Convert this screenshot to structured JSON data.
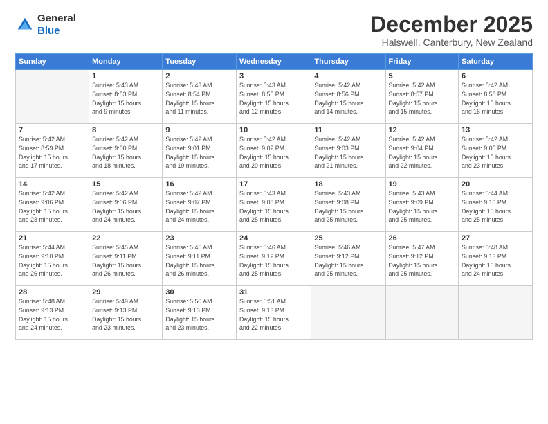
{
  "header": {
    "logo_general": "General",
    "logo_blue": "Blue",
    "month_title": "December 2025",
    "location": "Halswell, Canterbury, New Zealand"
  },
  "days_of_week": [
    "Sunday",
    "Monday",
    "Tuesday",
    "Wednesday",
    "Thursday",
    "Friday",
    "Saturday"
  ],
  "weeks": [
    [
      {
        "day": "",
        "info": ""
      },
      {
        "day": "1",
        "info": "Sunrise: 5:43 AM\nSunset: 8:53 PM\nDaylight: 15 hours\nand 9 minutes."
      },
      {
        "day": "2",
        "info": "Sunrise: 5:43 AM\nSunset: 8:54 PM\nDaylight: 15 hours\nand 11 minutes."
      },
      {
        "day": "3",
        "info": "Sunrise: 5:43 AM\nSunset: 8:55 PM\nDaylight: 15 hours\nand 12 minutes."
      },
      {
        "day": "4",
        "info": "Sunrise: 5:42 AM\nSunset: 8:56 PM\nDaylight: 15 hours\nand 14 minutes."
      },
      {
        "day": "5",
        "info": "Sunrise: 5:42 AM\nSunset: 8:57 PM\nDaylight: 15 hours\nand 15 minutes."
      },
      {
        "day": "6",
        "info": "Sunrise: 5:42 AM\nSunset: 8:58 PM\nDaylight: 15 hours\nand 16 minutes."
      }
    ],
    [
      {
        "day": "7",
        "info": "Sunrise: 5:42 AM\nSunset: 8:59 PM\nDaylight: 15 hours\nand 17 minutes."
      },
      {
        "day": "8",
        "info": "Sunrise: 5:42 AM\nSunset: 9:00 PM\nDaylight: 15 hours\nand 18 minutes."
      },
      {
        "day": "9",
        "info": "Sunrise: 5:42 AM\nSunset: 9:01 PM\nDaylight: 15 hours\nand 19 minutes."
      },
      {
        "day": "10",
        "info": "Sunrise: 5:42 AM\nSunset: 9:02 PM\nDaylight: 15 hours\nand 20 minutes."
      },
      {
        "day": "11",
        "info": "Sunrise: 5:42 AM\nSunset: 9:03 PM\nDaylight: 15 hours\nand 21 minutes."
      },
      {
        "day": "12",
        "info": "Sunrise: 5:42 AM\nSunset: 9:04 PM\nDaylight: 15 hours\nand 22 minutes."
      },
      {
        "day": "13",
        "info": "Sunrise: 5:42 AM\nSunset: 9:05 PM\nDaylight: 15 hours\nand 23 minutes."
      }
    ],
    [
      {
        "day": "14",
        "info": "Sunrise: 5:42 AM\nSunset: 9:06 PM\nDaylight: 15 hours\nand 23 minutes."
      },
      {
        "day": "15",
        "info": "Sunrise: 5:42 AM\nSunset: 9:06 PM\nDaylight: 15 hours\nand 24 minutes."
      },
      {
        "day": "16",
        "info": "Sunrise: 5:42 AM\nSunset: 9:07 PM\nDaylight: 15 hours\nand 24 minutes."
      },
      {
        "day": "17",
        "info": "Sunrise: 5:43 AM\nSunset: 9:08 PM\nDaylight: 15 hours\nand 25 minutes."
      },
      {
        "day": "18",
        "info": "Sunrise: 5:43 AM\nSunset: 9:08 PM\nDaylight: 15 hours\nand 25 minutes."
      },
      {
        "day": "19",
        "info": "Sunrise: 5:43 AM\nSunset: 9:09 PM\nDaylight: 15 hours\nand 25 minutes."
      },
      {
        "day": "20",
        "info": "Sunrise: 5:44 AM\nSunset: 9:10 PM\nDaylight: 15 hours\nand 25 minutes."
      }
    ],
    [
      {
        "day": "21",
        "info": "Sunrise: 5:44 AM\nSunset: 9:10 PM\nDaylight: 15 hours\nand 26 minutes."
      },
      {
        "day": "22",
        "info": "Sunrise: 5:45 AM\nSunset: 9:11 PM\nDaylight: 15 hours\nand 26 minutes."
      },
      {
        "day": "23",
        "info": "Sunrise: 5:45 AM\nSunset: 9:11 PM\nDaylight: 15 hours\nand 26 minutes."
      },
      {
        "day": "24",
        "info": "Sunrise: 5:46 AM\nSunset: 9:12 PM\nDaylight: 15 hours\nand 25 minutes."
      },
      {
        "day": "25",
        "info": "Sunrise: 5:46 AM\nSunset: 9:12 PM\nDaylight: 15 hours\nand 25 minutes."
      },
      {
        "day": "26",
        "info": "Sunrise: 5:47 AM\nSunset: 9:12 PM\nDaylight: 15 hours\nand 25 minutes."
      },
      {
        "day": "27",
        "info": "Sunrise: 5:48 AM\nSunset: 9:13 PM\nDaylight: 15 hours\nand 24 minutes."
      }
    ],
    [
      {
        "day": "28",
        "info": "Sunrise: 5:48 AM\nSunset: 9:13 PM\nDaylight: 15 hours\nand 24 minutes."
      },
      {
        "day": "29",
        "info": "Sunrise: 5:49 AM\nSunset: 9:13 PM\nDaylight: 15 hours\nand 23 minutes."
      },
      {
        "day": "30",
        "info": "Sunrise: 5:50 AM\nSunset: 9:13 PM\nDaylight: 15 hours\nand 23 minutes."
      },
      {
        "day": "31",
        "info": "Sunrise: 5:51 AM\nSunset: 9:13 PM\nDaylight: 15 hours\nand 22 minutes."
      },
      {
        "day": "",
        "info": ""
      },
      {
        "day": "",
        "info": ""
      },
      {
        "day": "",
        "info": ""
      }
    ]
  ]
}
